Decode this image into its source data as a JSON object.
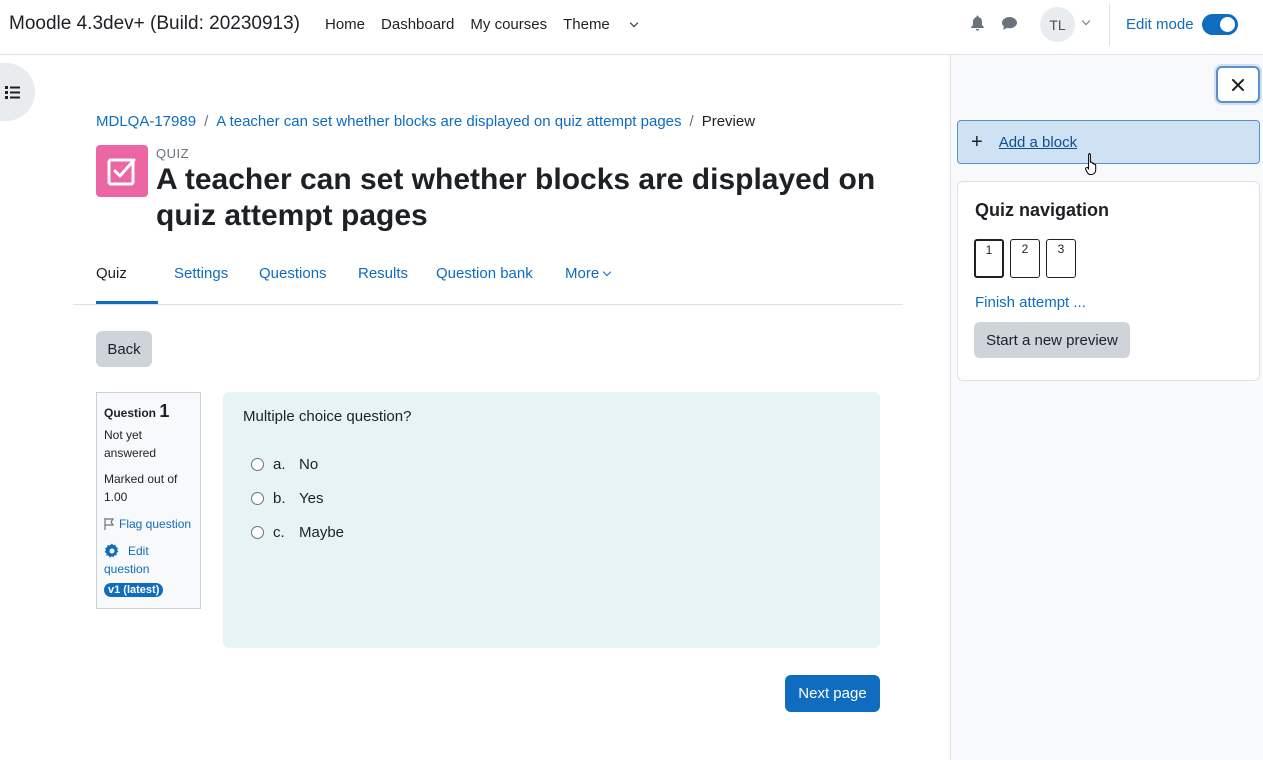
{
  "navbar": {
    "brand": "Moodle 4.3dev+ (Build: 20230913)",
    "links": [
      "Home",
      "Dashboard",
      "My courses"
    ],
    "theme_label": "Theme",
    "user_initials": "TL",
    "edit_mode_label": "Edit mode",
    "edit_mode_on": true
  },
  "breadcrumb": {
    "course": "MDLQA-17989",
    "activity": "A teacher can set whether blocks are displayed on quiz attempt pages",
    "current": "Preview",
    "separator": "/"
  },
  "header": {
    "activity_type": "QUIZ",
    "title": "A teacher can set whether blocks are displayed on quiz attempt pages",
    "icon_color": "#eb66a2"
  },
  "secondary_nav": {
    "tabs": [
      "Quiz",
      "Settings",
      "Questions",
      "Results",
      "Question bank",
      "More"
    ],
    "active": "Quiz"
  },
  "back_button": "Back",
  "question_info": {
    "label": "Question",
    "number": "1",
    "status_line1": "Not yet",
    "status_line2": "answered",
    "marked_line1": "Marked out of",
    "marked_line2": "1.00",
    "flag": "Flag question",
    "edit_line1": "Edit",
    "edit_line2": "question",
    "version_badge": "v1 (latest)"
  },
  "question": {
    "text": "Multiple choice question?",
    "options": [
      {
        "letter": "a.",
        "text": "No"
      },
      {
        "letter": "b.",
        "text": "Yes"
      },
      {
        "letter": "c.",
        "text": "Maybe"
      }
    ]
  },
  "next_button": "Next page",
  "drawer": {
    "add_block": "Add a block",
    "nav_title": "Quiz navigation",
    "question_buttons": [
      "1",
      "2",
      "3"
    ],
    "finish": "Finish attempt ...",
    "new_preview": "Start a new preview"
  },
  "colors": {
    "brand_blue": "#0f6cbf",
    "question_bg": "#e7f3f5",
    "quiz_icon": "#eb66a2"
  }
}
